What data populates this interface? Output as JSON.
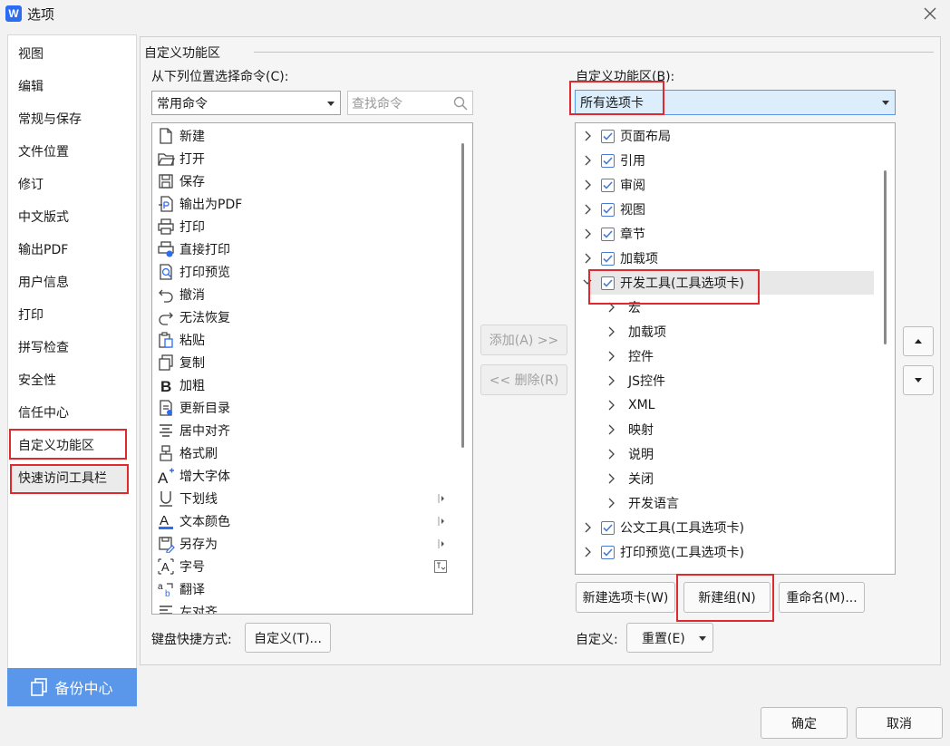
{
  "window": {
    "title": "选项",
    "app_icon_letter": "W"
  },
  "sidebar": {
    "items": [
      {
        "label": "视图"
      },
      {
        "label": "编辑"
      },
      {
        "label": "常规与保存"
      },
      {
        "label": "文件位置"
      },
      {
        "label": "修订"
      },
      {
        "label": "中文版式"
      },
      {
        "label": "输出PDF"
      },
      {
        "label": "用户信息"
      },
      {
        "label": "打印"
      },
      {
        "label": "拼写检查"
      },
      {
        "label": "安全性"
      },
      {
        "label": "信任中心"
      },
      {
        "label": "自定义功能区"
      },
      {
        "label": "快速访问工具栏"
      }
    ],
    "selected": "自定义功能区",
    "backup_label": "备份中心"
  },
  "section_title": "自定义功能区",
  "left": {
    "choose_label": "从下列位置选择命令(C):",
    "source_value": "常用命令",
    "search_placeholder": "查找命令",
    "commands": [
      {
        "label": "新建",
        "icon": "new-doc-icon"
      },
      {
        "label": "打开",
        "icon": "folder-open-icon"
      },
      {
        "label": "保存",
        "icon": "save-icon"
      },
      {
        "label": "输出为PDF",
        "icon": "pdf-icon"
      },
      {
        "label": "打印",
        "icon": "printer-icon"
      },
      {
        "label": "直接打印",
        "icon": "direct-print-icon"
      },
      {
        "label": "打印预览",
        "icon": "print-preview-icon"
      },
      {
        "label": "撤消",
        "icon": "undo-icon"
      },
      {
        "label": "无法恢复",
        "icon": "redo-icon"
      },
      {
        "label": "粘贴",
        "icon": "paste-icon"
      },
      {
        "label": "复制",
        "icon": "copy-icon"
      },
      {
        "label": "加粗",
        "icon": "bold-icon"
      },
      {
        "label": "更新目录",
        "icon": "update-toc-icon"
      },
      {
        "label": "居中对齐",
        "icon": "align-center-icon"
      },
      {
        "label": "格式刷",
        "icon": "format-painter-icon"
      },
      {
        "label": "增大字体",
        "icon": "grow-font-icon"
      },
      {
        "label": "下划线",
        "icon": "underline-icon",
        "submenu": true
      },
      {
        "label": "文本颜色",
        "icon": "font-color-icon",
        "submenu": true
      },
      {
        "label": "另存为",
        "icon": "save-as-icon",
        "submenu": true
      },
      {
        "label": "字号",
        "icon": "font-size-icon",
        "dropdown": true
      },
      {
        "label": "翻译",
        "icon": "translate-icon"
      },
      {
        "label": "左对齐",
        "icon": "align-left-icon"
      }
    ],
    "keyboard_label": "键盘快捷方式:",
    "customize_button": "自定义(T)..."
  },
  "middle": {
    "add_button": "添加(A) >>",
    "remove_button": "<< 删除(R)"
  },
  "right": {
    "ribbon_label": "自定义功能区(B):",
    "ribbon_value": "所有选项卡",
    "tree": [
      {
        "label": "页面布局",
        "checked": true,
        "level": 0,
        "expanded": false
      },
      {
        "label": "引用",
        "checked": true,
        "level": 0,
        "expanded": false
      },
      {
        "label": "审阅",
        "checked": true,
        "level": 0,
        "expanded": false
      },
      {
        "label": "视图",
        "checked": true,
        "level": 0,
        "expanded": false
      },
      {
        "label": "章节",
        "checked": true,
        "level": 0,
        "expanded": false
      },
      {
        "label": "加载项",
        "checked": true,
        "level": 0,
        "expanded": false
      },
      {
        "label": "开发工具(工具选项卡)",
        "checked": true,
        "level": 0,
        "expanded": true,
        "selected": true
      },
      {
        "label": "宏",
        "level": 1
      },
      {
        "label": "加载项",
        "level": 1
      },
      {
        "label": "控件",
        "level": 1
      },
      {
        "label": "JS控件",
        "level": 1
      },
      {
        "label": "XML",
        "level": 1
      },
      {
        "label": "映射",
        "level": 1
      },
      {
        "label": "说明",
        "level": 1
      },
      {
        "label": "关闭",
        "level": 1
      },
      {
        "label": "开发语言",
        "level": 1
      },
      {
        "label": "公文工具(工具选项卡)",
        "checked": true,
        "level": 0,
        "expanded": false
      },
      {
        "label": "打印预览(工具选项卡)",
        "checked": true,
        "level": 0,
        "expanded": false
      }
    ],
    "new_tab_button": "新建选项卡(W)",
    "new_group_button": "新建组(N)",
    "rename_button": "重命名(M)...",
    "customize_label": "自定义:",
    "reset_button": "重置(E)",
    "move_up_icon": "triangle-up-icon",
    "move_down_icon": "triangle-down-icon"
  },
  "footer": {
    "ok_button": "确定",
    "cancel_button": "取消"
  },
  "colors": {
    "highlight_border": "#e0282f",
    "backup_bg": "#5a97ea",
    "selected_combo_bg": "#dceefc",
    "checkbox": "#4a7bd0"
  }
}
